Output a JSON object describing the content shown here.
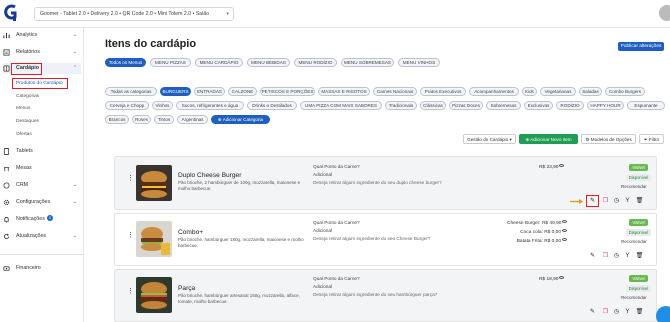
{
  "topbar": {
    "store": "Goomer - Tablet 2.0 • Delivery 2.0 • QR Code 2.0 • Mini Totem 2.0 • Salão"
  },
  "sidebar": {
    "items": [
      {
        "label": "Analytics",
        "icon": "chart-icon"
      },
      {
        "label": "Relatórios",
        "icon": "report-icon"
      },
      {
        "label": "Cardápio",
        "icon": "menu-book-icon"
      },
      {
        "label": "Tablets",
        "icon": "tablet-icon"
      },
      {
        "label": "Mesas",
        "icon": "table-icon"
      },
      {
        "label": "CRM",
        "icon": "crm-icon"
      },
      {
        "label": "Configurações",
        "icon": "gear-icon"
      },
      {
        "label": "Notificações",
        "icon": "bell-icon",
        "badge": "3"
      },
      {
        "label": "Atualizações",
        "icon": "update-icon"
      },
      {
        "label": "Financeiro",
        "icon": "finance-icon"
      }
    ],
    "subitems": [
      "Produtos do Cardápio",
      "Categorias",
      "Menus",
      "Destaques",
      "Ofertas"
    ]
  },
  "main": {
    "title": "Itens do cardápio",
    "publish_btn": "Publicar alterações",
    "menu_tabs": [
      "Todos os Menus",
      "MENU PIZZAS",
      "MENU CARDÁPIO",
      "MENU BEBIDAS",
      "MENU RODÍZIO",
      "MENU SOBREMESAS",
      "MENU VINHOS"
    ],
    "categories_row1": [
      "Todas as categorias",
      "BURGUERS",
      "ENTRADAS",
      "CALZONE",
      "PETISCOS E PORÇÕES",
      "MASSAS E RISOTOS",
      "Carnes Nacionais",
      "Pratos Executivos",
      "Acompanhamentos",
      "Kids",
      "Vegetarianas",
      "Saladas",
      "Combo Burgers"
    ],
    "categories_row2": [
      "Cerveja e Chopp",
      "Vinhos",
      "Sucos, refrigerantes e água",
      "Drinks e Destilados",
      "UMA PIZZA COM MAIS SABORES",
      "Tradicionais",
      "Clássicas",
      "Pizzas Doces",
      "Sobremesas",
      "Exclusivas",
      "RODÍZIO",
      "HAPPY HOUR",
      "Espumante"
    ],
    "categories_row3": [
      "Brancos",
      "Roses",
      "Tintos",
      "Argentinas"
    ],
    "add_category": "Adicionar Categoria",
    "toolbar": {
      "manage": "Gestão do Cardápio",
      "add_item": "Adicionar Novo Item",
      "templates": "Modelos de Opções",
      "filter": "Filtro"
    },
    "products": [
      {
        "name": "Duplo Cheese Burger",
        "desc": "Pão brioche, 2 hambúrguer de 100g, mozzarella, maionese e molho barbecue.",
        "q1": "Qual Ponto da Carne?",
        "q2": "Adicional",
        "q3": "Deseja retirar algum ingrediente do seu duplo cheese burger?",
        "price": "R$ 23,90",
        "tags": [
          "Visível",
          "Disponível"
        ],
        "recommend": "Recomendar"
      },
      {
        "name": "Combo+",
        "desc": "Pão brioche, hambúrguer 180g, mozzarella, maionese e molho barbecue.",
        "q1": "Qual Ponto da Carne?",
        "q2": "Adicional",
        "q3": "Deseja retirar algum ingrediente do seu Cheese Burger?",
        "prices": [
          {
            "label": "Cheese Burger:",
            "value": "R$ 49,90"
          },
          {
            "label": "Coca cola:",
            "value": "R$ 0,00"
          },
          {
            "label": "Batata Frita:",
            "value": "R$ 0,00"
          }
        ],
        "tags": [
          "Visível",
          "Disponível"
        ],
        "recommend": "Recomendar"
      },
      {
        "name": "Parça",
        "desc": "Pão brioche, hambúrguer artesanal 150g, mozzarella, alface, tomate, molho barbecue.",
        "q1": "Qual Ponto da Carne?",
        "q2": "Adicional",
        "q3": "Deseja retirar algum ingrediente do seu hambúrguer parça?",
        "price": "R$ 18,90",
        "tags": [
          "Visível",
          "Disponível"
        ],
        "recommend": "Recomendar"
      }
    ]
  },
  "colors": {
    "primary": "#1f5fbf",
    "success": "#1f9d55",
    "highlight": "#e21b2a"
  }
}
